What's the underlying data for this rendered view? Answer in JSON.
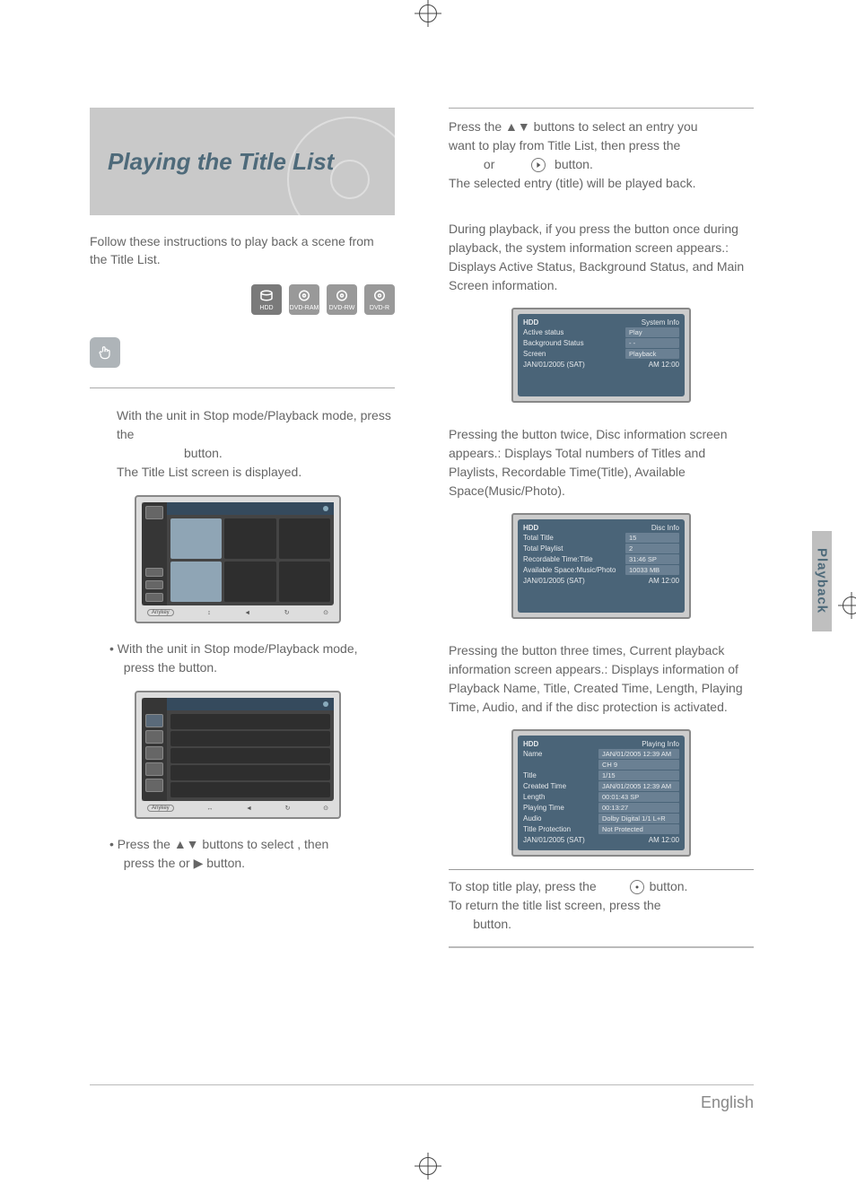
{
  "header_title": "Playing the Title List",
  "intro": "Follow these instructions to play back a scene from the Title List.",
  "disc_icons": [
    "HDD",
    "DVD-RAM",
    "DVD-RW",
    "DVD-R"
  ],
  "step1": {
    "line1": "With the unit in Stop mode/Playback mode, press the",
    "line2": "button.",
    "line3": "The Title List screen is displayed."
  },
  "bullet1a": "With the unit in Stop mode/Playback mode,",
  "bullet1b": "press the             button.",
  "bullet2a": "Press the ▲▼ buttons to select        , then",
  "bullet2b": "press the            or ▶ button.",
  "right_p1": {
    "a": "Press the ▲▼ buttons to select an entry you",
    "b": "want to play from Title List, then press the",
    "c": "or             button.",
    "d": "The selected entry (title) will be played back."
  },
  "right_p2": "During playback, if you press the        button once during playback, the system information screen appears.: Displays Active Status, Background Status, and Main Screen information.",
  "right_p3": "Pressing the        button twice, Disc information screen appears.: Displays Total numbers of Titles and Playlists, Recordable Time(Title), Available Space(Music/Photo).",
  "right_p4": "Pressing the        button three times, Current playback information screen appears.: Displays information of Playback Name, Title, Created Time, Length, Playing Time, Audio, and if the disc protection is activated.",
  "panel_system": {
    "title_left": "HDD",
    "title_right": "System Info",
    "rows": [
      {
        "label": "Active status",
        "val": "Play"
      },
      {
        "label": "Background Status",
        "val": "- -"
      },
      {
        "label": "Screen",
        "val": "Playback"
      }
    ],
    "footer_left": "JAN/01/2005 (SAT)",
    "footer_right": "AM 12:00"
  },
  "panel_disc": {
    "title_left": "HDD",
    "title_right": "Disc Info",
    "rows": [
      {
        "label": "Total Title",
        "val": "15"
      },
      {
        "label": "Total Playlist",
        "val": "2"
      },
      {
        "label": "Recordable Time:Title",
        "val": "31:46  SP"
      },
      {
        "label": "Available Space:Music/Photo",
        "val": "10033 MB"
      }
    ],
    "footer_left": "JAN/01/2005 (SAT)",
    "footer_right": "AM 12:00"
  },
  "panel_playing": {
    "title_left": "HDD",
    "title_right": "Playing Info",
    "rows": [
      {
        "label": "Name",
        "val": "JAN/01/2005 12:39 AM"
      },
      {
        "label": "",
        "val": "CH 9"
      },
      {
        "label": "Title",
        "val": "1/15"
      },
      {
        "label": "Created Time",
        "val": "JAN/01/2005 12:39 AM"
      },
      {
        "label": "Length",
        "val": "00:01:43 SP"
      },
      {
        "label": "Playing Time",
        "val": "00:13:27"
      },
      {
        "label": "Audio",
        "val": "Dolby Digital 1/1 L+R"
      },
      {
        "label": "Title Protection",
        "val": "Not Protected"
      }
    ],
    "footer_left": "JAN/01/2005 (SAT)",
    "footer_right": "AM 12:00"
  },
  "stop_note": {
    "a": "To stop title play, press the               button.",
    "b": "To return the title list screen, press the",
    "c": "button."
  },
  "section_tab": "Playback",
  "footer": "English"
}
